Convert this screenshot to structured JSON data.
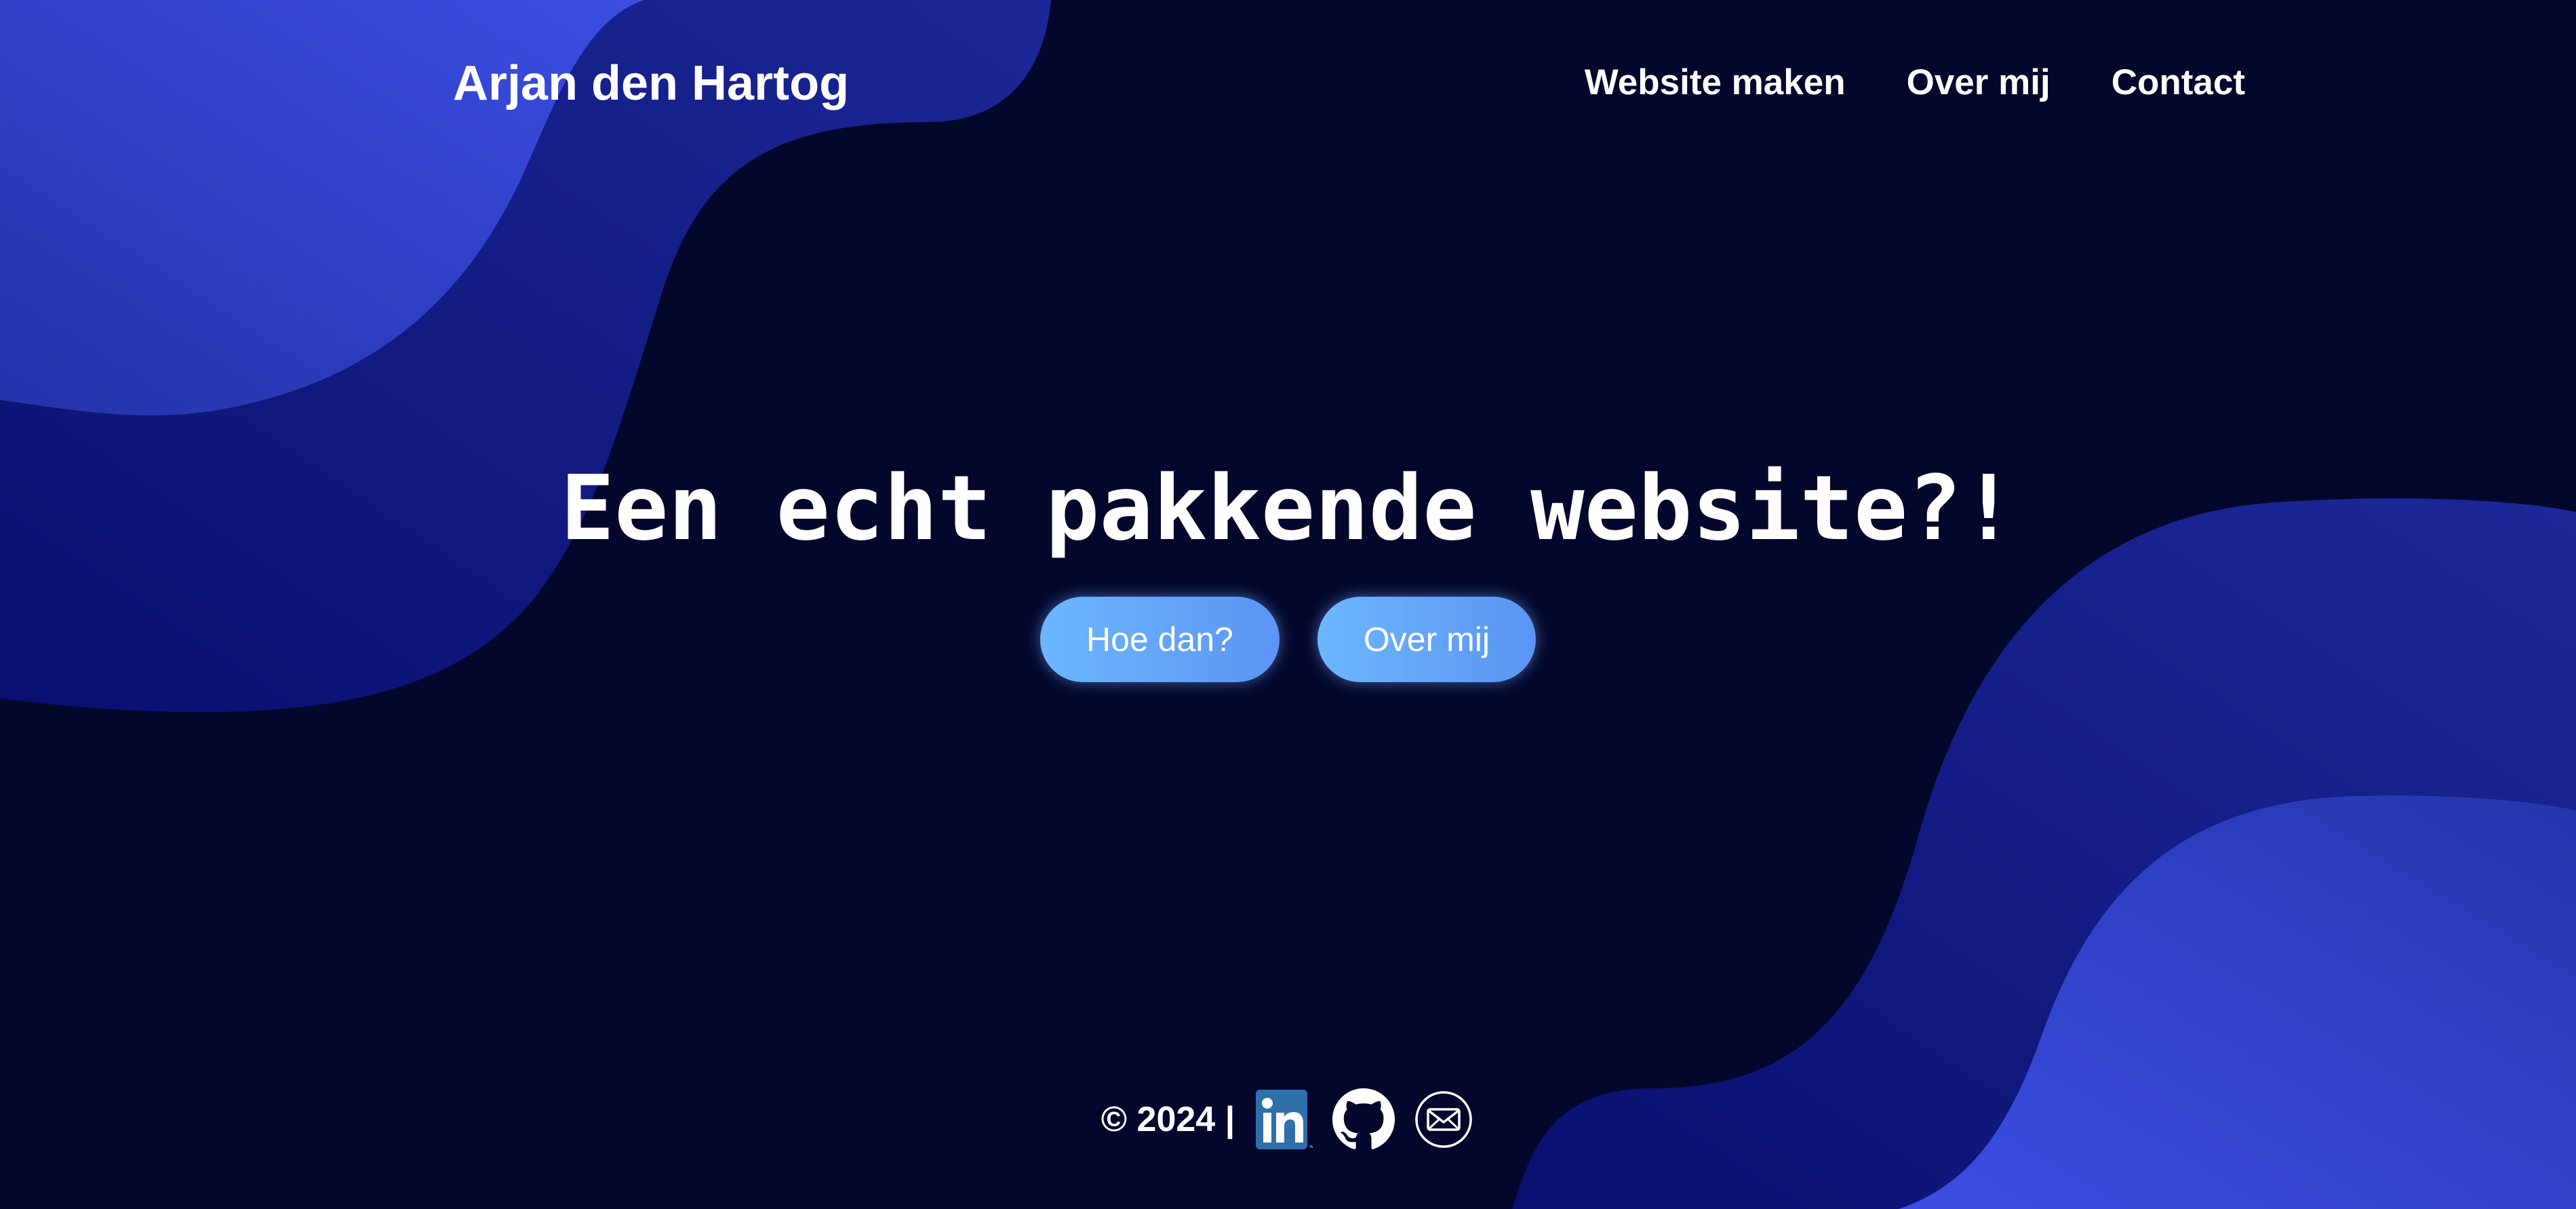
{
  "header": {
    "brand": "Arjan den Hartog",
    "nav": [
      {
        "label": "Website maken"
      },
      {
        "label": "Over mij"
      },
      {
        "label": "Contact"
      }
    ]
  },
  "hero": {
    "title": "Een echt pakkende website?!",
    "buttons": [
      {
        "label": "Hoe dan?"
      },
      {
        "label": "Over mij"
      }
    ]
  },
  "footer": {
    "copyright": "© 2024 |",
    "social": [
      {
        "icon": "linkedin-icon"
      },
      {
        "icon": "github-icon"
      },
      {
        "icon": "mail-icon"
      }
    ]
  },
  "colors": {
    "background": "#04072c",
    "wave_light": "#3a4de0",
    "wave_dark": "#1a2494",
    "button_start": "#6cb6ff",
    "button_end": "#5b95f2",
    "linkedin": "#2f6faa"
  }
}
